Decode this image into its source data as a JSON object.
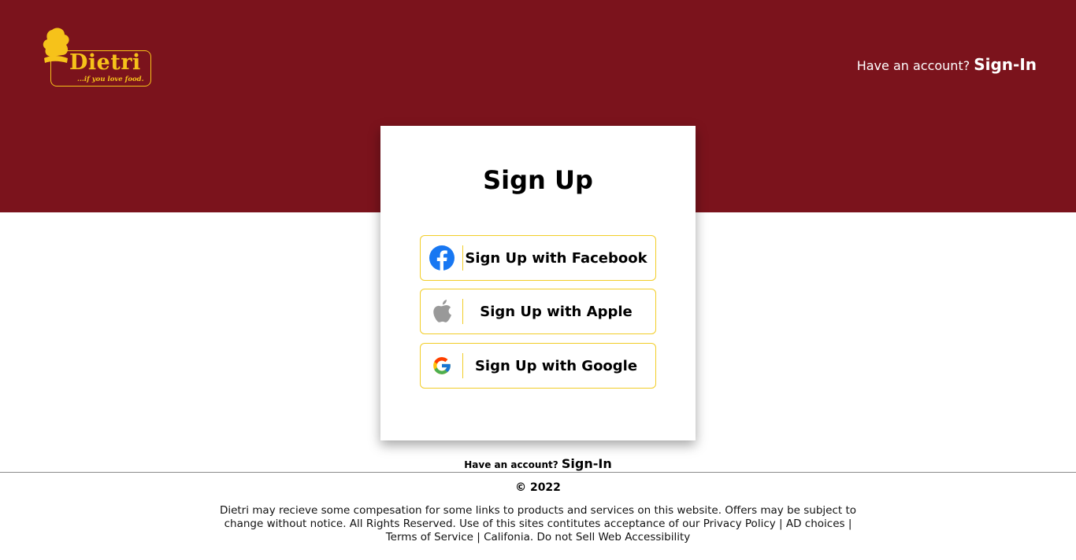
{
  "brand": {
    "name": "Dietri",
    "tagline": "...if you love food.",
    "colors": {
      "primary": "#7b131c",
      "accent": "#f6c21a"
    }
  },
  "header": {
    "account_prompt": "Have an account?",
    "signin_label": "Sign-In"
  },
  "card": {
    "title": "Sign Up",
    "buttons": [
      {
        "label": "Sign Up with Facebook",
        "icon": "facebook-icon"
      },
      {
        "label": "Sign Up with Apple",
        "icon": "apple-icon"
      },
      {
        "label": "Sign Up with Google",
        "icon": "google-icon"
      }
    ]
  },
  "below_card": {
    "account_prompt": "Have an account?",
    "signin_label": "Sign-In"
  },
  "footer": {
    "copyright": "© 2022",
    "disclaimer": "Dietri may recieve some compesation for some links to products and services on this website. Offers may be subject to change without notice. All Rights Reserved. Use of this sites contitutes acceptance of our Privacy Policy | AD choices | Terms of Service | Califonia. Do not Sell Web Accessibility"
  }
}
